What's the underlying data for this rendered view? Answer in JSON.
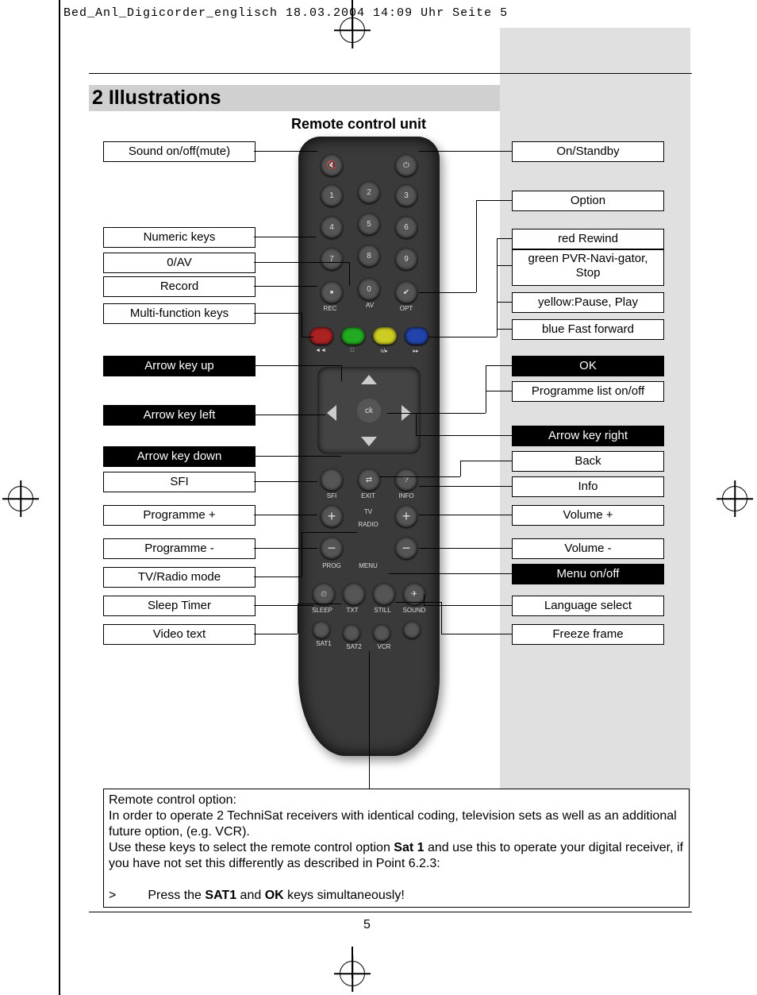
{
  "header": "Bed_Anl_Digicorder_englisch  18.03.2004  14:09 Uhr  Seite 5",
  "section_title": "2 Illustrations",
  "subtitle": "Remote control unit",
  "page_number": "5",
  "left_callouts": {
    "mute": "Sound on/off(mute)",
    "numeric": "Numeric keys",
    "zero_av": "0/AV",
    "record": "Record",
    "multi": "Multi-function keys",
    "arrow_up": "Arrow key up",
    "arrow_left": "Arrow key left",
    "arrow_down": "Arrow key down",
    "sfi": "SFI",
    "prog_plus": "Programme +",
    "prog_minus": "Programme -",
    "tv_radio": "TV/Radio mode",
    "sleep": "Sleep Timer",
    "videotext": "Video text"
  },
  "right_callouts": {
    "standby": "On/Standby",
    "option": "Option",
    "red": "red Rewind",
    "green": "green PVR-Navi-gator, Stop",
    "yellow": "yellow:Pause, Play",
    "blue": "blue Fast forward",
    "ok": "OK",
    "proglist": "Programme list on/off",
    "arrow_right": "Arrow key right",
    "back": "Back",
    "info": "Info",
    "vol_plus": "Volume +",
    "vol_minus": "Volume -",
    "menu": "Menu on/off",
    "language": "Language select",
    "freeze": "Freeze frame"
  },
  "remote_labels": {
    "rec": "REC",
    "av": "AV",
    "opt": "OPT",
    "ok": "ck",
    "sfi": "SFI",
    "exit": "EXIT",
    "info": "INFO",
    "tv": "TV",
    "radio": "RADIO",
    "prog": "PROG",
    "menu": "MENU",
    "sleep": "SLEEP",
    "txt": "TXT",
    "still": "STILL",
    "sound": "SOUND",
    "sat1": "SAT1",
    "sat2": "SAT2",
    "vcr": "VCR",
    "plus": "+",
    "minus": "−",
    "question": "?",
    "swap": "⇄",
    "rewind": "◄◄",
    "stop": "□",
    "play": "ıı/▸",
    "ffwd": "▸▸"
  },
  "numbers": [
    "1",
    "2",
    "3",
    "4",
    "5",
    "6",
    "7",
    "8",
    "9",
    "0"
  ],
  "note": {
    "line1": "Remote control option:",
    "line2": "In order to operate 2 TechniSat receivers with identical coding, television sets as well as an additional future option, (e.g. VCR).",
    "line3a": "Use these keys to select the remote control option ",
    "line3b": "Sat 1",
    "line3c": " and use this to operate your digital receiver, if you have not set this differently as described in Point 6.2.3:",
    "bullet": ">",
    "line4a": "Press the ",
    "line4b": "SAT1",
    "line4c": " and ",
    "line4d": "OK",
    "line4e": " keys simultaneously!"
  }
}
